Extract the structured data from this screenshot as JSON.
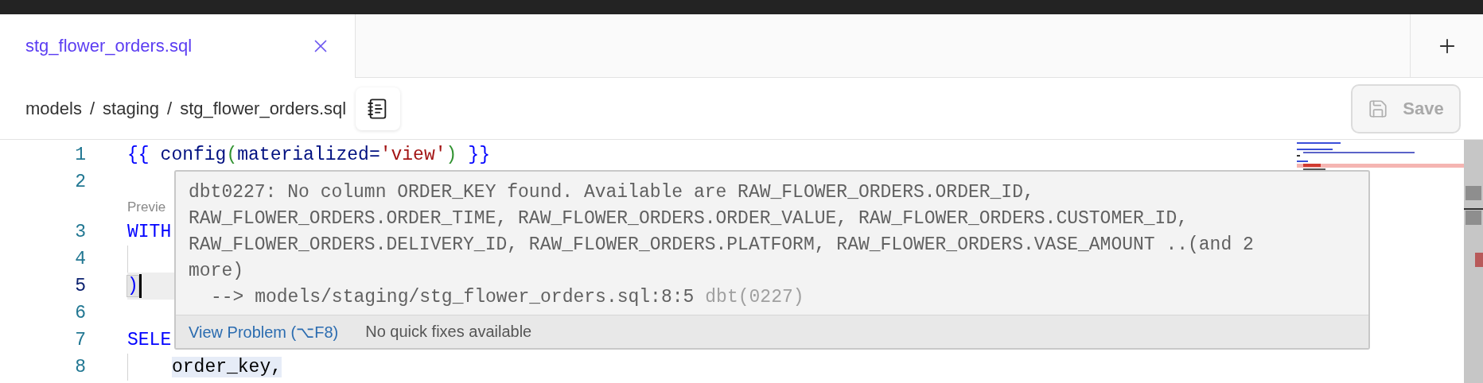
{
  "tabs": [
    {
      "label": "stg_flower_orders.sql",
      "selected": true
    }
  ],
  "breadcrumb": {
    "segments": [
      "models",
      "staging",
      "stg_flower_orders.sql"
    ],
    "separator": "/"
  },
  "save_button": {
    "label": "Save",
    "disabled": true
  },
  "editor": {
    "rows": [
      {
        "kind": "code",
        "number": "1",
        "active": false,
        "indented": false,
        "words": [
          [
            {
              "text": "{{",
              "kind": "jinja"
            }
          ],
          [
            {
              "text": "config",
              "kind": "ident"
            },
            {
              "text": "(",
              "kind": "paren"
            },
            {
              "text": "materialized=",
              "kind": "ident"
            },
            {
              "text": "'view'",
              "kind": "string"
            },
            {
              "text": ")",
              "kind": "paren"
            }
          ],
          [
            {
              "text": "}}",
              "kind": "jinja"
            }
          ]
        ]
      },
      {
        "kind": "code",
        "number": "2",
        "active": false,
        "indented": false,
        "words": []
      },
      {
        "kind": "codelens",
        "text": "Previe"
      },
      {
        "kind": "code",
        "number": "3",
        "active": false,
        "indented": false,
        "words": [
          [
            {
              "text": "WITH",
              "kind": "keyword"
            }
          ]
        ]
      },
      {
        "kind": "code",
        "number": "4",
        "active": false,
        "indented": true,
        "words": []
      },
      {
        "kind": "code",
        "number": "5",
        "active": true,
        "indented": false,
        "words": [
          [
            {
              "text": ")",
              "kind": "bracket"
            }
          ]
        ]
      },
      {
        "kind": "code",
        "number": "6",
        "active": false,
        "indented": false,
        "words": []
      },
      {
        "kind": "code",
        "number": "7",
        "active": false,
        "indented": false,
        "words": [
          [
            {
              "text": "SELE",
              "kind": "keyword"
            }
          ]
        ]
      },
      {
        "kind": "code",
        "number": "8",
        "active": false,
        "indented": true,
        "words": [
          [
            {
              "text": "order_key,",
              "kind": "error"
            }
          ]
        ]
      }
    ]
  },
  "hover": {
    "message_lines": [
      "dbt0227: No column ORDER_KEY found. Available are RAW_FLOWER_ORDERS.ORDER_ID,",
      "RAW_FLOWER_ORDERS.ORDER_TIME, RAW_FLOWER_ORDERS.ORDER_VALUE, RAW_FLOWER_ORDERS.CUSTOMER_ID,",
      "RAW_FLOWER_ORDERS.DELIVERY_ID, RAW_FLOWER_ORDERS.PLATFORM, RAW_FLOWER_ORDERS.VASE_AMOUNT ..(and 2",
      "more)"
    ],
    "location": "--> models/staging/stg_flower_orders.sql:8:5",
    "source": "dbt(0227)",
    "action": "View Problem (⌥F8)",
    "note": "No quick fixes available"
  }
}
